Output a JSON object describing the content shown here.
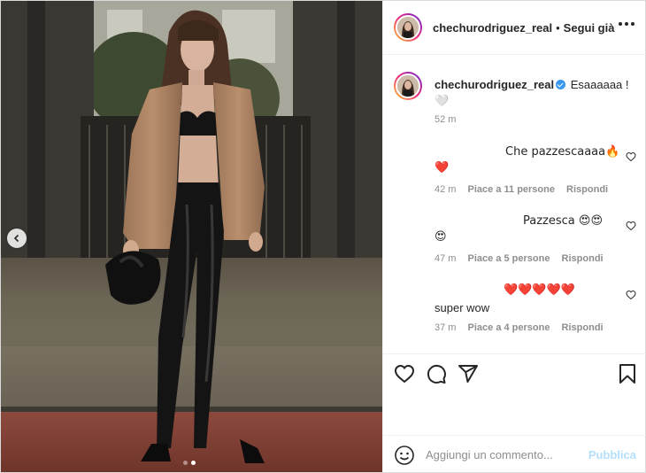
{
  "post": {
    "username": "chechurodriguez_real",
    "separator": "•",
    "follow_status": "Segui già",
    "caption": {
      "username": "chechurodriguez_real",
      "text": "Esaaaaaa !",
      "emoji": "🤍",
      "time": "52 m"
    },
    "comments": [
      {
        "text": "Che pazzescaaaa🔥",
        "emoji_line": "❤️",
        "time": "42 m",
        "likes": "Piace a 11 persone",
        "reply": "Rispondi"
      },
      {
        "text": "Pazzesca 😍😍",
        "emoji_line": "😍",
        "time": "47 m",
        "likes": "Piace a 5 persone",
        "reply": "Rispondi"
      },
      {
        "hearts": "❤️❤️❤️❤️❤️",
        "text": "super wow",
        "time": "37 m",
        "likes": "Piace a 4 persone",
        "reply": "Rispondi"
      }
    ],
    "add_comment": {
      "placeholder": "Aggiungi un commento...",
      "publish": "Pubblica"
    },
    "carousel": {
      "total": 2,
      "active": 2
    }
  },
  "icons": {
    "prev": "chevron-left-icon",
    "more": "more-icon",
    "like": "heart-icon",
    "comment": "comment-icon",
    "share": "share-icon",
    "save": "bookmark-icon",
    "emoji": "emoji-icon",
    "verified": "verified-badge-icon"
  },
  "colors": {
    "accent": "#3897f0",
    "publish_disabled": "#b2dffc",
    "heart_red": "#ed4956",
    "text": "#262626",
    "muted": "#8e8e8e"
  }
}
